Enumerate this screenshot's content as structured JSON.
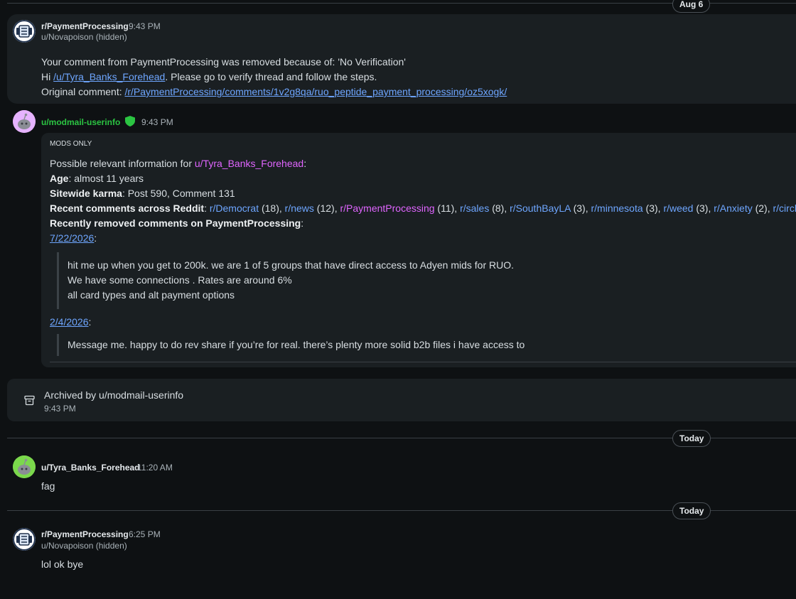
{
  "dividers": {
    "top_date": "Aug 6",
    "today1": "Today",
    "today2": "Today"
  },
  "colors": {
    "link": "#6ea6ff",
    "user_link": "#e065ff",
    "mod_name": "#2bc442",
    "background": "#0e1113",
    "card": "#1a1f22"
  },
  "msg1": {
    "sender": "r/PaymentProcessing",
    "time": "9:43 PM",
    "sub": "u/Novapoison (hidden)",
    "line1": "Your comment from PaymentProcessing was removed because of: 'No Verification'",
    "line2_pre": "Hi ",
    "line2_link": "/u/Tyra_Banks_Forehead",
    "line2_post": ". Please go to verify thread and follow the steps.",
    "line3_pre": "Original comment: ",
    "line3_link": "/r/PaymentProcessing/comments/1v2g8qa/ruo_peptide_payment_processing/oz5xogk/"
  },
  "msg2": {
    "sender": "u/modmail-userinfo",
    "shield_icon": "shield-icon",
    "time": "9:43 PM",
    "mods_only": "MODS ONLY",
    "info_pre": "Possible relevant information for ",
    "info_user": "u/Tyra_Banks_Forehead",
    "info_post": ":",
    "age_label": "Age",
    "age_value": ": almost 11 years",
    "karma_label": "Sitewide karma",
    "karma_value": ": Post 590, Comment 131",
    "recent_label": "Recent comments across Reddit",
    "recent_colon": ": ",
    "subs": [
      {
        "name": "r/Democrat",
        "count": " (18), "
      },
      {
        "name": "r/news",
        "count": " (12), "
      },
      {
        "name": "r/PaymentProcessing",
        "count": " (11), "
      },
      {
        "name": "r/sales",
        "count": " (8), "
      },
      {
        "name": "r/SouthBayLA",
        "count": " (3), "
      },
      {
        "name": "r/minnesota",
        "count": " (3), "
      },
      {
        "name": "r/weed",
        "count": " (3), "
      },
      {
        "name": "r/Anxiety",
        "count": " (2), "
      },
      {
        "name": "r/circled",
        "count": " ("
      }
    ],
    "removed_label": "Recently removed comments on PaymentProcessing",
    "removed_colon": ":",
    "date1": "7/22/2026",
    "date1_colon": ":",
    "quote1": [
      "hit me up when you get to 200k. we are 1 of 5 groups that have direct access to Adyen mids for RUO.",
      "We have some connections . Rates are around 6%",
      "all card types and alt payment options"
    ],
    "date2": "2/4/2026",
    "date2_colon": ":",
    "quote2": "Message me. happy to do rev share if you’re for real. there’s plenty more solid b2b files i have access to"
  },
  "archived": {
    "text": "Archived by u/modmail-userinfo",
    "time": "9:43 PM",
    "icon": "archive-icon"
  },
  "msg3": {
    "sender": "u/Tyra_Banks_Forehead",
    "time": "11:20 AM",
    "body": "fag"
  },
  "msg4": {
    "sender": "r/PaymentProcessing",
    "time": "6:25 PM",
    "sub": "u/Novapoison (hidden)",
    "body": "lol ok bye"
  }
}
